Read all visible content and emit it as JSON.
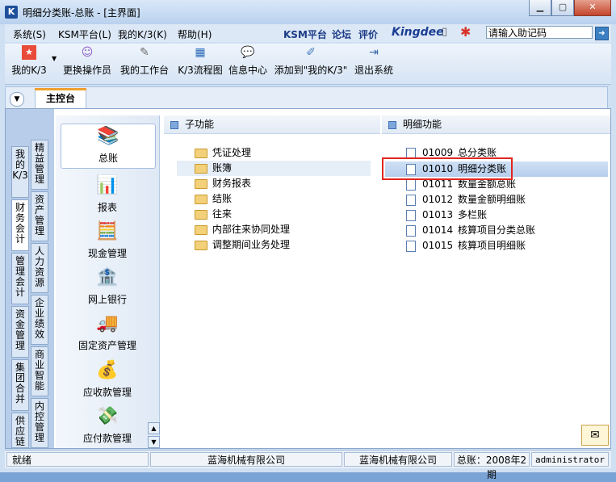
{
  "window": {
    "title": "明细分类账-总账 - [主界面]",
    "app_icon_text": "K"
  },
  "menubar": {
    "items": [
      "系统(S)",
      "KSM平台(L)",
      "我的K/3(K)",
      "帮助(H)"
    ],
    "brand_links": [
      "KSM平台",
      "论坛",
      "评价"
    ],
    "kingdee": "Kingdee",
    "helper_placeholder": "请输入助记码"
  },
  "toolbar": {
    "items": [
      "我的K/3",
      "更换操作员",
      "我的工作台",
      "K/3流程图",
      "信息中心",
      "添加到\"我的K/3\"",
      "退出系统"
    ]
  },
  "tabs": {
    "main": "主控台"
  },
  "left_tabs": {
    "col1": [
      "我的K/3",
      "财务会计",
      "管理会计",
      "资金管理",
      "集团合并",
      "供应链"
    ],
    "col2": [
      "精益管理",
      "资产管理",
      "人力资源",
      "企业绩效",
      "商业智能",
      "内控管理"
    ]
  },
  "modules": [
    {
      "label": "总账",
      "icon": "ledger-books-icon",
      "glyph": "📚"
    },
    {
      "label": "报表",
      "icon": "report-icon",
      "glyph": "📊"
    },
    {
      "label": "现金管理",
      "icon": "cash-calculator-icon",
      "glyph": "🧮"
    },
    {
      "label": "网上银行",
      "icon": "bank-icon",
      "glyph": "🏦"
    },
    {
      "label": "固定资产管理",
      "icon": "truck-icon",
      "glyph": "🚚"
    },
    {
      "label": "应收款管理",
      "icon": "money-bag-icon",
      "glyph": "💰"
    },
    {
      "label": "应付款管理",
      "icon": "payment-icon",
      "glyph": "💸"
    }
  ],
  "sub_panel": {
    "title": "子功能",
    "items": [
      "凭证处理",
      "账簿",
      "财务报表",
      "结账",
      "往来",
      "内部往来协同处理",
      "调整期间业务处理"
    ]
  },
  "detail_panel": {
    "title": "明细功能",
    "items": [
      {
        "code": "01009",
        "name": "总分类账"
      },
      {
        "code": "01010",
        "name": "明细分类账"
      },
      {
        "code": "01011",
        "name": "数量金额总账"
      },
      {
        "code": "01012",
        "name": "数量金额明细账"
      },
      {
        "code": "01013",
        "name": "多栏账"
      },
      {
        "code": "01014",
        "name": "核算项目分类总账"
      },
      {
        "code": "01015",
        "name": "核算项目明细账"
      }
    ]
  },
  "statusbar": {
    "ready": "就绪",
    "company1": "蓝海机械有限公司",
    "company2": "蓝海机械有限公司",
    "period": "总账：2008年2期",
    "user": "administrator"
  },
  "colors": {
    "accent_orange": "#f0a030",
    "highlight_red": "#e0261f",
    "brand_blue": "#1a3e94"
  }
}
